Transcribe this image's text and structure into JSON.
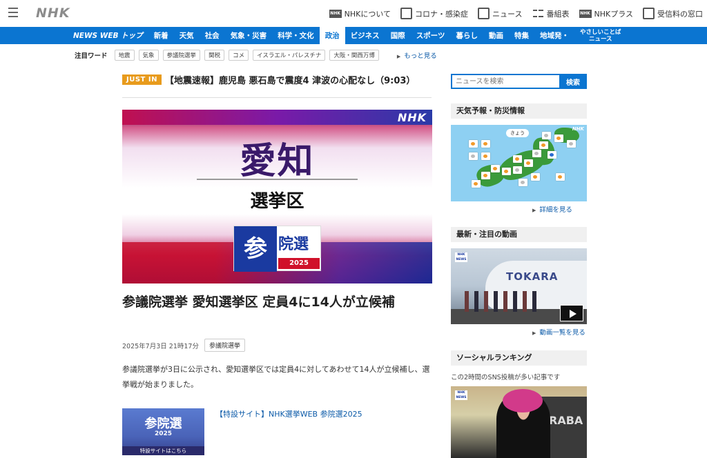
{
  "header": {
    "logo": "NHK",
    "links": [
      {
        "label": "NHKについて",
        "icon": "nhk-logo-icon"
      },
      {
        "label": "コロナ・感染症",
        "icon": "virus-icon"
      },
      {
        "label": "ニュース",
        "icon": "news-icon"
      },
      {
        "label": "番組表",
        "icon": "grid-icon"
      },
      {
        "label": "NHKプラス",
        "icon": "nhk-plus-icon"
      },
      {
        "label": "受信料の窓口",
        "icon": "tv-icon"
      }
    ],
    "nhk_badge": "NHK"
  },
  "nav": {
    "brand": "NEWS WEB トップ",
    "items": [
      "新着",
      "天気",
      "社会",
      "気象・災害",
      "科学・文化",
      "政治",
      "ビジネス",
      "国際",
      "スポーツ",
      "暮らし",
      "動画",
      "特集",
      "地域発・"
    ],
    "active": "政治",
    "easy_line1": "やさしいことば",
    "easy_line2": "ニュース",
    "accent": "#0b75d1"
  },
  "keywords": {
    "label": "注目ワード",
    "items": [
      "地震",
      "気象",
      "参議院選挙",
      "関税",
      "コメ",
      "イスラエル・パレスチナ",
      "大阪・関西万博"
    ],
    "more": "もっと見る"
  },
  "justin": {
    "badge": "JUST IN",
    "text": "【地震速報】鹿児島 悪石島で震度4 津波の心配なし（9:03）"
  },
  "hero": {
    "watermark": "NHK",
    "big": "愛知",
    "sub": "選挙区",
    "san": "参",
    "inkyo": "院選",
    "year": "2025"
  },
  "article": {
    "title": "参議院選挙 愛知選挙区 定員4に14人が立候補",
    "date": "2025年7月3日 21時17分",
    "tag": "参議院選挙",
    "lead": "参議院選挙が3日に公示され、愛知選挙区では定員4に対してあわせて14人が立候補し、選挙戦が始まりました。"
  },
  "special": {
    "thumb_title": "参院選",
    "thumb_year": "2025",
    "thumb_cta": "特設サイトはこちら",
    "link": "【特設サイト】NHK選挙WEB 参院選2025"
  },
  "sidebar": {
    "search_placeholder": "ニュースを検索",
    "search_button": "検索",
    "weather_title": "天気予報・防災情報",
    "weather_today": "きょう",
    "weather_wm": "NHK",
    "weather_more": "詳細を見る",
    "video_title": "最新・注目の動画",
    "video_ship": "TOKARA",
    "video_more": "動画一覧を見る",
    "news_badge_1": "NHK",
    "news_badge_2": "NEWS",
    "ranking_title": "ソーシャルランキング",
    "ranking_sub": "この2時間のSNS投稿が多い記事です",
    "ranking_bg_text": "RABA"
  }
}
